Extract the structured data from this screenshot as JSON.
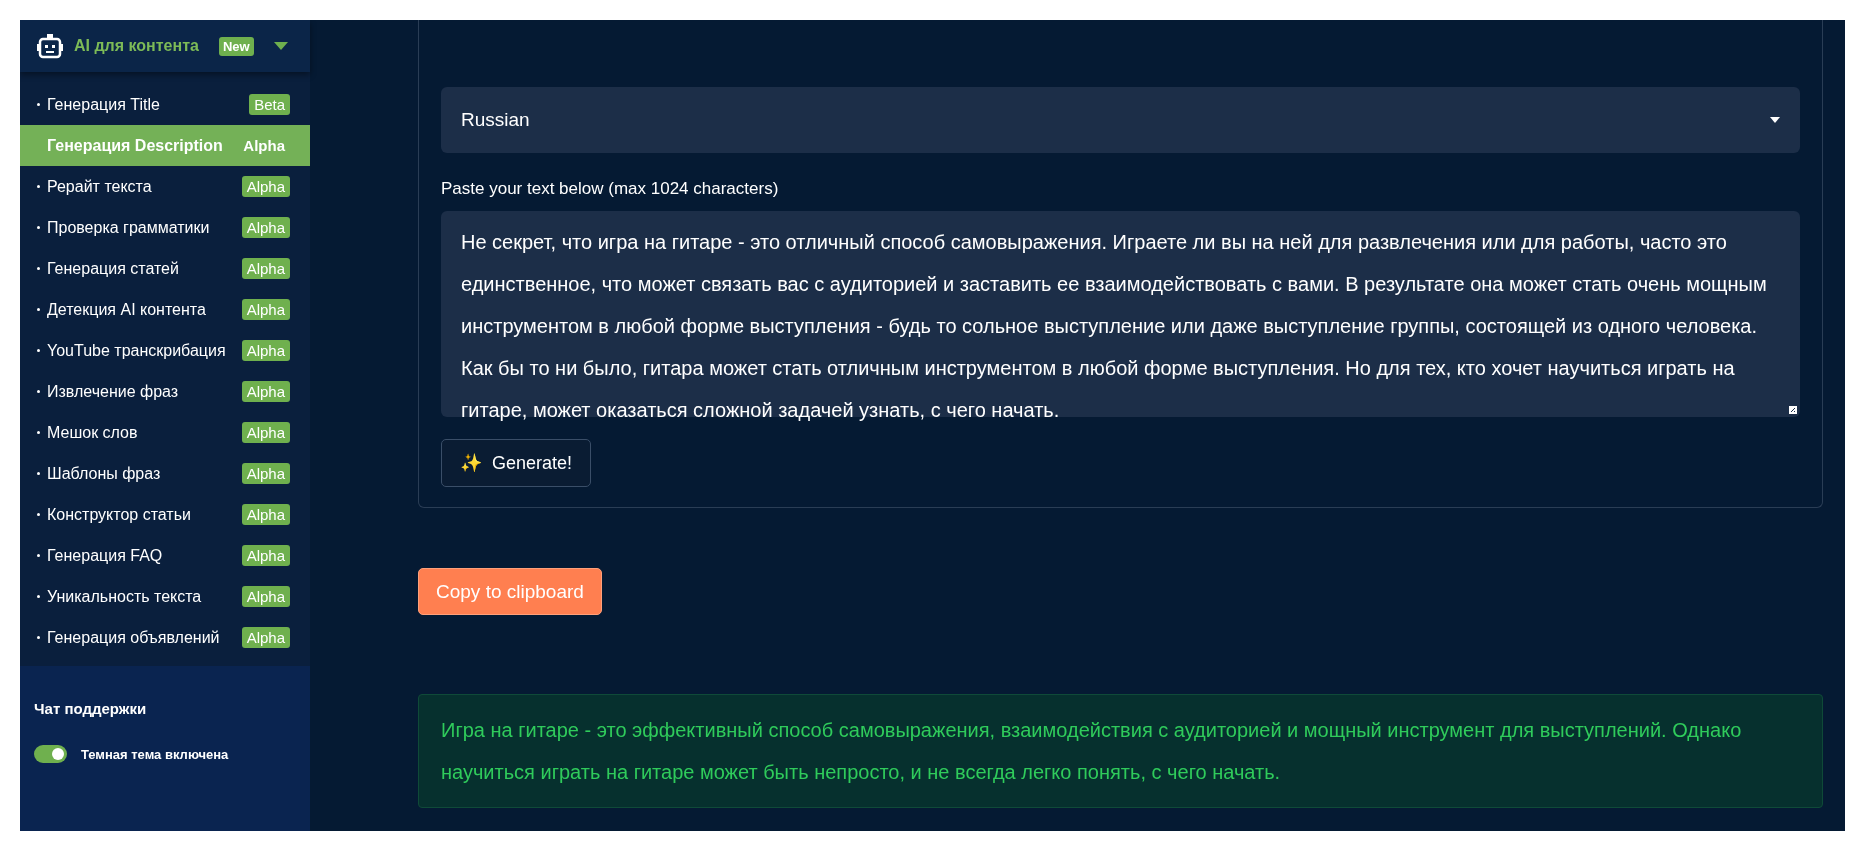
{
  "sidebar": {
    "header": {
      "title": "AI для контента",
      "badge": "New"
    },
    "items": [
      {
        "label": "Генерация Title",
        "badge": "Beta",
        "selected": false
      },
      {
        "label": "Генерация Description",
        "badge": "Alpha",
        "selected": true
      },
      {
        "label": "Рерайт текста",
        "badge": "Alpha",
        "selected": false
      },
      {
        "label": "Проверка грамматики",
        "badge": "Alpha",
        "selected": false
      },
      {
        "label": "Генерация статей",
        "badge": "Alpha",
        "selected": false
      },
      {
        "label": "Детекция AI контента",
        "badge": "Alpha",
        "selected": false
      },
      {
        "label": "YouTube транскрибация",
        "badge": "Alpha",
        "selected": false
      },
      {
        "label": "Извлечение фраз",
        "badge": "Alpha",
        "selected": false
      },
      {
        "label": "Мешок слов",
        "badge": "Alpha",
        "selected": false
      },
      {
        "label": "Шаблоны фраз",
        "badge": "Alpha",
        "selected": false
      },
      {
        "label": "Конструктор статьи",
        "badge": "Alpha",
        "selected": false
      },
      {
        "label": "Генерация FAQ",
        "badge": "Alpha",
        "selected": false
      },
      {
        "label": "Уникальность текста",
        "badge": "Alpha",
        "selected": false
      },
      {
        "label": "Генерация объявлений",
        "badge": "Alpha",
        "selected": false
      }
    ],
    "footer": {
      "support": "Чат поддержки",
      "theme_toggle": {
        "label": "Темная тема включена",
        "on": true
      }
    }
  },
  "main": {
    "language_select": {
      "value": "Russian"
    },
    "text_input": {
      "label": "Paste your text below (max 1024 characters)",
      "value": "Не секрет, что игра на гитаре - это отличный способ самовыражения. Играете ли вы на ней для развлечения или для работы, часто это единственное, что может связать вас с аудиторией и заставить ее взаимодействовать с вами. В результате она может стать очень мощным инструментом в любой форме выступления - будь то сольное выступление или даже выступление группы, состоящей из одного человека. Как бы то ни было, гитара может стать отличным инструментом в любой форме выступления. Но для тех, кто хочет научиться играть на гитаре, может оказаться сложной задачей узнать, с чего начать."
    },
    "generate_button": {
      "icon": "✨",
      "label": "Generate!"
    },
    "copy_button": "Copy to clipboard",
    "result": "Игра на гитаре - это эффективный способ самовыражения, взаимодействия с аудиторией и мощный инструмент для выступлений. Однако научиться играть на гитаре может быть непросто, и не всегда легко понять, с чего начать."
  }
}
